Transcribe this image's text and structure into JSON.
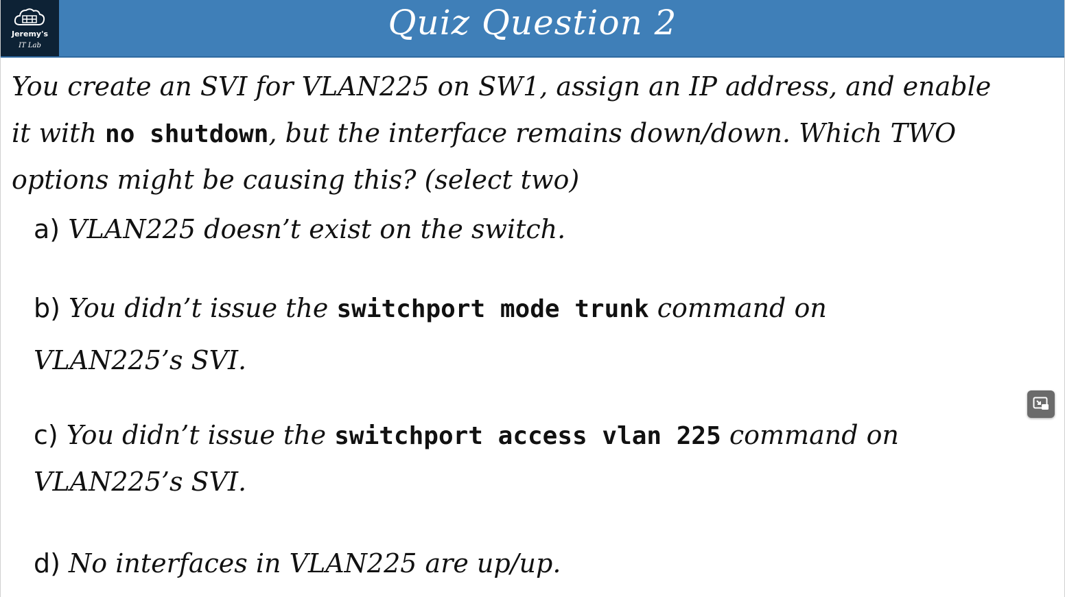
{
  "header": {
    "title": "Quiz Question 2",
    "logo_name": "Jeremy's",
    "logo_sub": "IT Lab"
  },
  "question": {
    "line1": "You create an SVI for VLAN225 on SW1, assign an IP address, and enable",
    "line2_pre": "it with ",
    "line2_cmd": "no shutdown",
    "line2_post": ", but the interface remains down/down.  Which TWO",
    "line3": "options might be causing this?  (select two)"
  },
  "options": {
    "a": {
      "letter": "a)",
      "text": " VLAN225 doesn’t exist on the switch."
    },
    "b": {
      "letter": "b)",
      "pre": " You didn’t issue the ",
      "cmd": "switchport mode trunk",
      "post": " command on",
      "line2": "VLAN225’s SVI."
    },
    "c": {
      "letter": "c)",
      "pre": " You didn’t issue the ",
      "cmd": "switchport access vlan 225",
      "post": " command on",
      "line2": "VLAN225’s SVI."
    },
    "d": {
      "letter": "d)",
      "text": " No interfaces in VLAN225 are up/up."
    }
  },
  "controls": {
    "expand_icon": "picture-in-picture-exit-icon"
  },
  "colors": {
    "header_bg": "#3f7fb8",
    "logo_bg": "#0d2235",
    "text": "#111111"
  }
}
